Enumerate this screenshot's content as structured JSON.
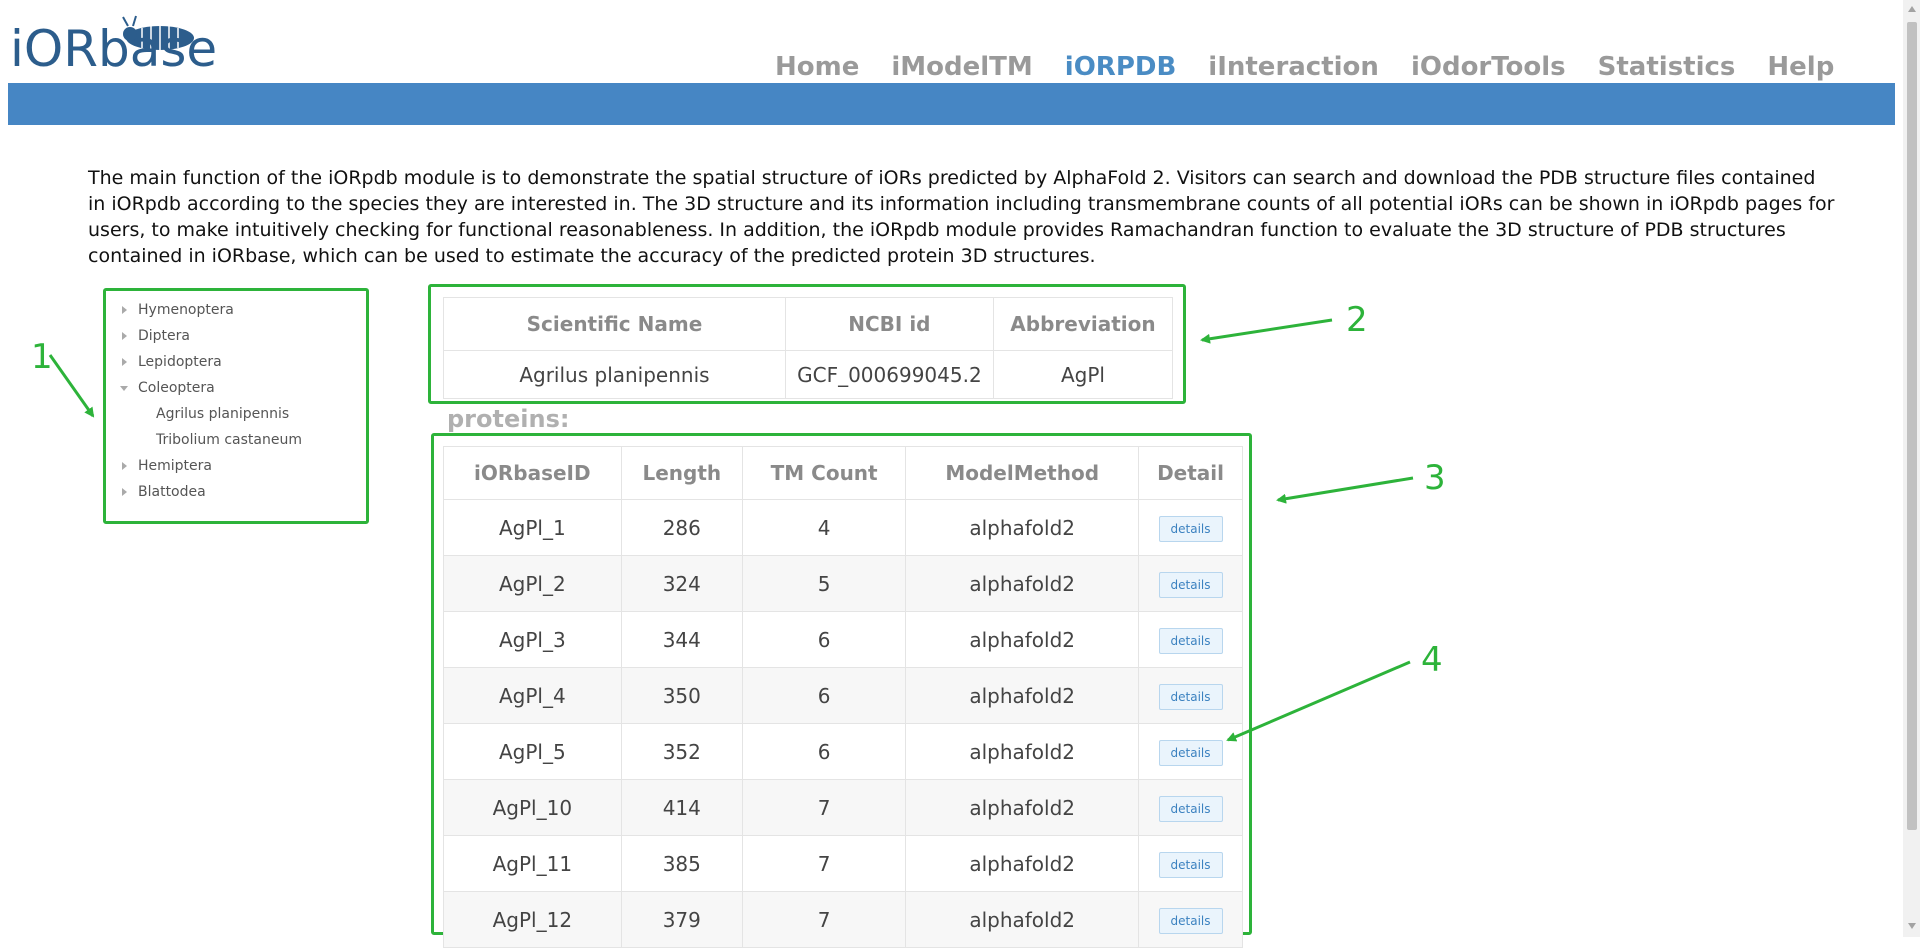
{
  "header": {
    "logo_text": "iORbase",
    "nav": [
      {
        "label": "Home",
        "active": false
      },
      {
        "label": "iModelTM",
        "active": false
      },
      {
        "label": "iORPDB",
        "active": true
      },
      {
        "label": "iInteraction",
        "active": false
      },
      {
        "label": "iOdorTools",
        "active": false
      },
      {
        "label": "Statistics",
        "active": false
      },
      {
        "label": "Help",
        "active": false
      }
    ]
  },
  "intro": {
    "text": "The main function of the iORpdb module is to demonstrate the spatial structure of iORs predicted by AlphaFold 2. Visitors can search and download the PDB structure files contained in iORpdb according to the species they are interested in. The 3D structure and its information including transmembrane counts of all potential iORs can be shown in iORpdb pages for users, to make intuitively checking for functional reasonableness. In addition, the iORpdb module provides Ramachandran function to evaluate the 3D structure of PDB structures contained in iORbase, which can be used to estimate the accuracy of the predicted protein 3D structures."
  },
  "tree": {
    "orders": [
      {
        "label": "Hymenoptera",
        "expanded": false,
        "children": []
      },
      {
        "label": "Diptera",
        "expanded": false,
        "children": []
      },
      {
        "label": "Lepidoptera",
        "expanded": false,
        "children": []
      },
      {
        "label": "Coleoptera",
        "expanded": true,
        "children": [
          "Agrilus planipennis",
          "Tribolium castaneum"
        ]
      },
      {
        "label": "Hemiptera",
        "expanded": false,
        "children": []
      },
      {
        "label": "Blattodea",
        "expanded": false,
        "children": []
      }
    ]
  },
  "species": {
    "headers": [
      "Scientific Name",
      "NCBI id",
      "Abbreviation"
    ],
    "row": [
      "Agrilus planipennis",
      "GCF_000699045.2",
      "AgPl"
    ]
  },
  "proteins": {
    "label": "proteins:",
    "headers": [
      "iORbaseID",
      "Length",
      "TM Count",
      "ModelMethod",
      "Detail"
    ],
    "button_label": "details",
    "rows": [
      [
        "AgPl_1",
        "286",
        "4",
        "alphafold2"
      ],
      [
        "AgPl_2",
        "324",
        "5",
        "alphafold2"
      ],
      [
        "AgPl_3",
        "344",
        "6",
        "alphafold2"
      ],
      [
        "AgPl_4",
        "350",
        "6",
        "alphafold2"
      ],
      [
        "AgPl_5",
        "352",
        "6",
        "alphafold2"
      ],
      [
        "AgPl_10",
        "414",
        "7",
        "alphafold2"
      ],
      [
        "AgPl_11",
        "385",
        "7",
        "alphafold2"
      ],
      [
        "AgPl_12",
        "379",
        "7",
        "alphafold2"
      ]
    ]
  },
  "annotations": {
    "labels": [
      "1",
      "2",
      "3",
      "4"
    ],
    "color": "#2db33a"
  },
  "colors": {
    "brand_blue": "#4686c4",
    "nav_active": "#4a8cc4",
    "nav_inactive": "#9a9a9a",
    "annotation_green": "#2db33a"
  }
}
